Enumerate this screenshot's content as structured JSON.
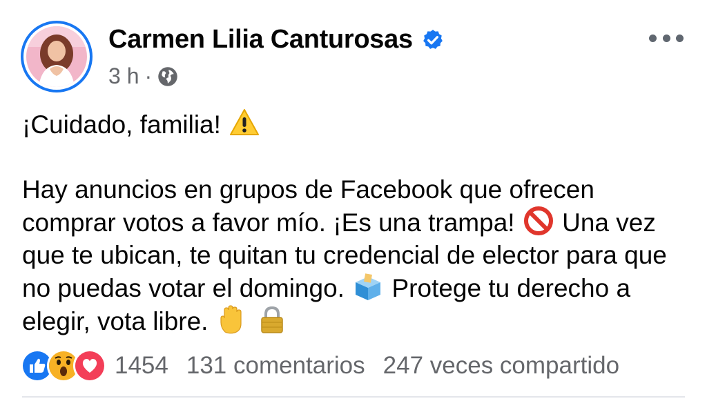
{
  "post": {
    "author": {
      "name": "Carmen Lilia Canturosas",
      "verified": true,
      "avatar_icon": "profile-photo"
    },
    "meta": {
      "time": "3 h",
      "separator": "·",
      "audience_icon": "globe-icon"
    },
    "text": {
      "line1": "¡Cuidado, familia!",
      "p2_a": "Hay anuncios en grupos de Facebook que ofrecen comprar votos a favor mío. ¡Es una trampa!",
      "p2_b": "Una vez que te ubican, te quitan tu credencial de elector para que no puedas votar el domingo.",
      "p2_c": "Protege tu derecho a elegir, vota libre."
    },
    "emojis": [
      "warning",
      "prohibited",
      "ballot-box",
      "raised-hand",
      "locked"
    ],
    "engagement": {
      "reactions": [
        "like",
        "wow",
        "love"
      ],
      "reaction_count": "1454",
      "comments": "131 comentarios",
      "shares": "247 veces compartido"
    },
    "colors": {
      "brand_blue": "#1877f2",
      "secondary_text": "#65676b",
      "love_red": "#f33e58",
      "wow_yellow": "#f7b125"
    }
  }
}
